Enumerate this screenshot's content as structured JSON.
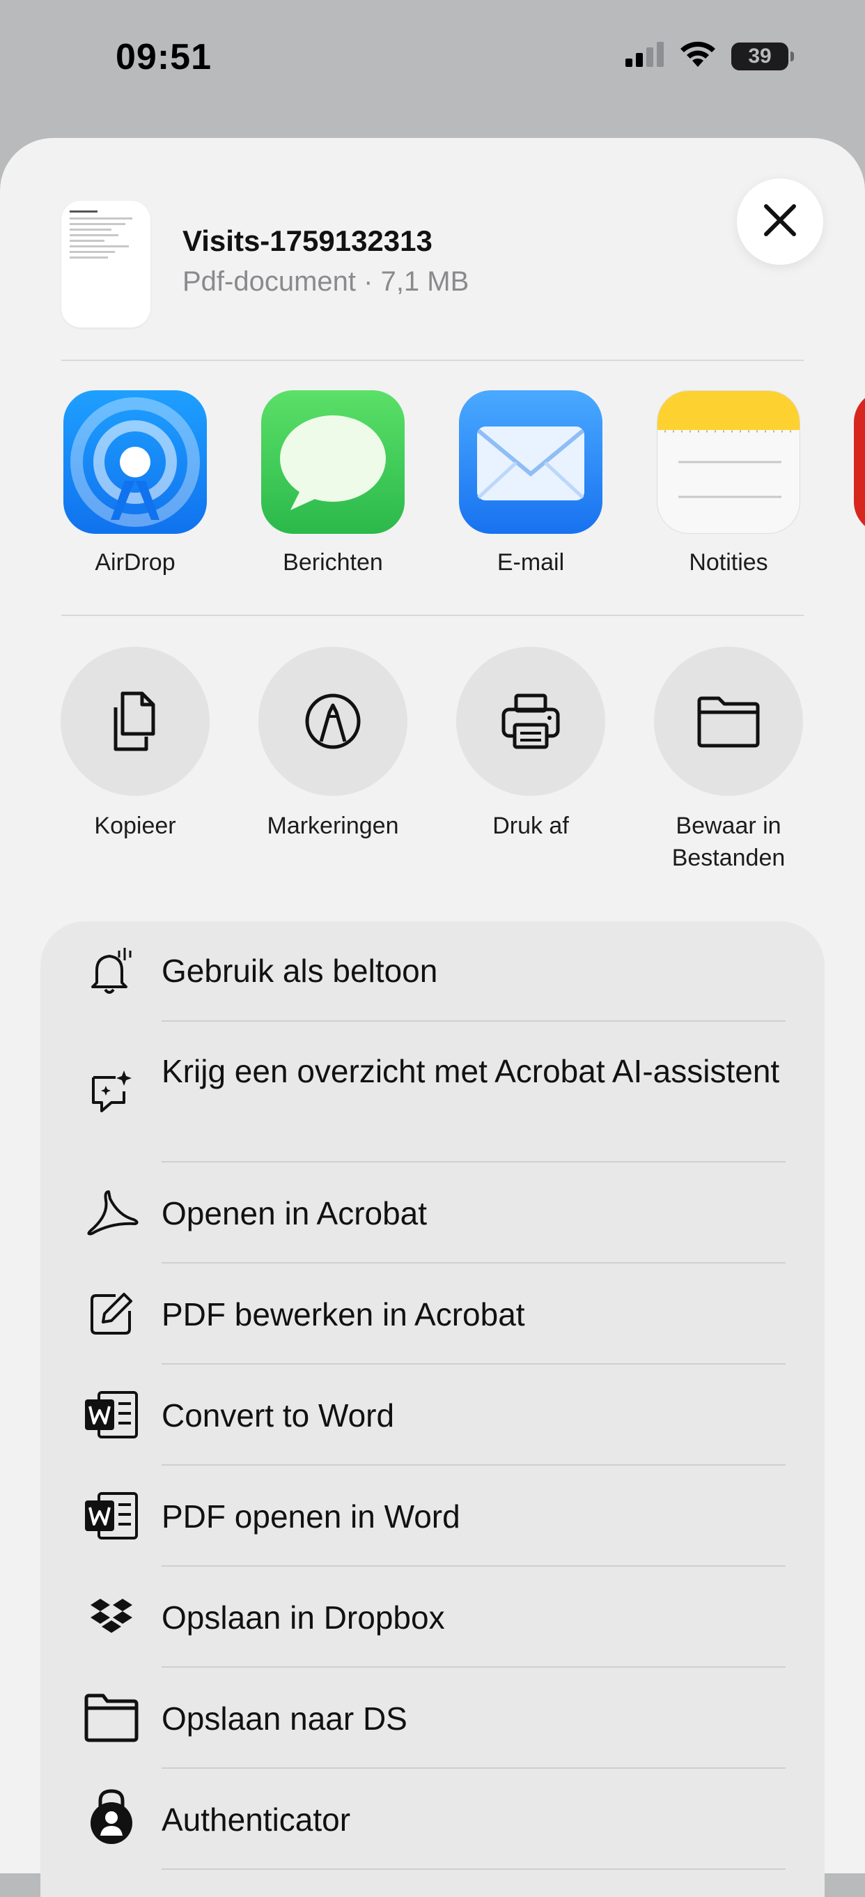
{
  "status_bar": {
    "time": "09:51",
    "battery_level": "39"
  },
  "share_sheet": {
    "document": {
      "title": "Visits-1759132313",
      "subtitle": "Pdf-document · 7,1 MB"
    },
    "apps": [
      {
        "label": "AirDrop",
        "icon": "airdrop-icon"
      },
      {
        "label": "Berichten",
        "icon": "messages-icon"
      },
      {
        "label": "E-mail",
        "icon": "mail-icon"
      },
      {
        "label": "Notities",
        "icon": "notes-icon"
      }
    ],
    "actions": [
      {
        "label": "Kopieer",
        "icon": "copy-icon"
      },
      {
        "label": "Markeringen",
        "icon": "markup-icon"
      },
      {
        "label": "Druk af",
        "icon": "print-icon"
      },
      {
        "label": "Bewaar in Bestanden",
        "icon": "folder-icon"
      }
    ],
    "list": [
      {
        "label": "Gebruik als beltoon",
        "icon": "bell-icon"
      },
      {
        "label": "Krijg een overzicht met Acrobat AI-assistent",
        "icon": "ai-assistant-icon"
      },
      {
        "label": "Openen in Acrobat",
        "icon": "acrobat-icon"
      },
      {
        "label": "PDF bewerken in Acrobat",
        "icon": "edit-icon"
      },
      {
        "label": "Convert to Word",
        "icon": "word-icon"
      },
      {
        "label": "PDF openen in Word",
        "icon": "word-icon"
      },
      {
        "label": "Opslaan in Dropbox",
        "icon": "dropbox-icon"
      },
      {
        "label": "Opslaan naar DS",
        "icon": "folder-icon"
      },
      {
        "label": "Authenticator",
        "icon": "authenticator-icon"
      }
    ]
  },
  "colors": {
    "airdrop": "#1e8cf5",
    "messages": "#34c759",
    "mail": "#2a8af6",
    "notes_header": "#fdd130"
  }
}
